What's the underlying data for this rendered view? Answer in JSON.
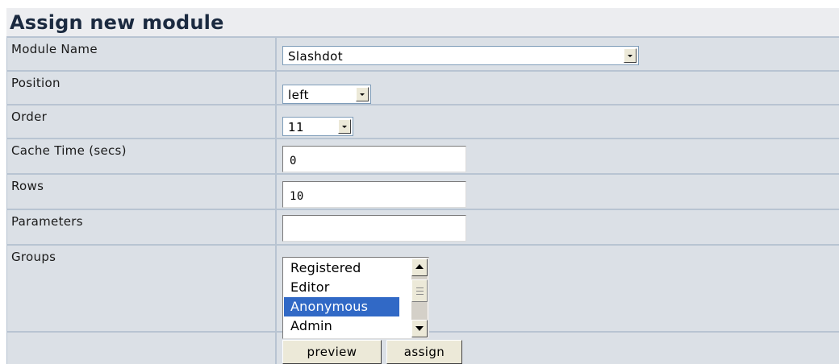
{
  "title": "Assign new module",
  "fields": {
    "module_name": {
      "label": "Module Name",
      "value": "Slashdot"
    },
    "position": {
      "label": "Position",
      "value": "left"
    },
    "order": {
      "label": "Order",
      "value": "11"
    },
    "cache_time": {
      "label": "Cache Time (secs)",
      "value": "0"
    },
    "rows": {
      "label": "Rows",
      "value": "10"
    },
    "parameters": {
      "label": "Parameters",
      "value": ""
    },
    "groups": {
      "label": "Groups",
      "options": [
        "Registered",
        "Editor",
        "Anonymous",
        "Admin"
      ],
      "selected": "Anonymous"
    }
  },
  "buttons": {
    "preview": "preview",
    "assign": "assign"
  },
  "colors": {
    "title_bg": "#ecedf0",
    "cell_bg": "#dbe0e6",
    "border": "#b8c4d2",
    "selection": "#3169c6"
  }
}
